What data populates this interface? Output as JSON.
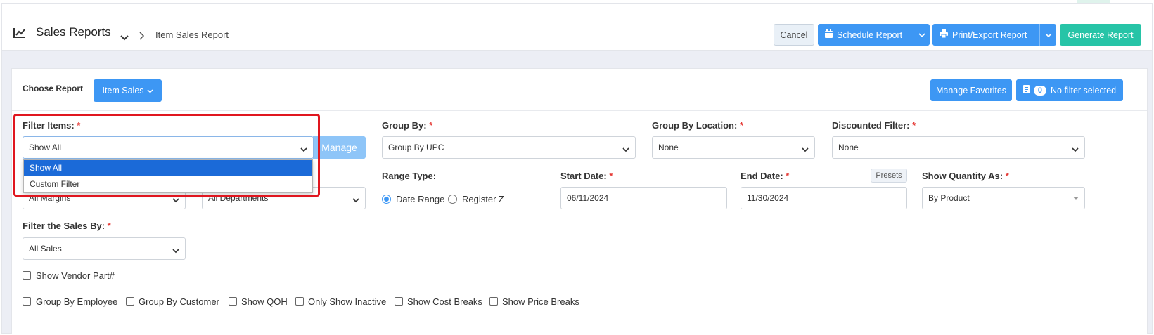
{
  "header": {
    "title": "Sales Reports",
    "breadcrumb": "Item Sales Report",
    "cancel_label": "Cancel",
    "schedule_label": "Schedule Report",
    "print_label": "Print/Export Report",
    "generate_label": "Generate Report"
  },
  "choose": {
    "label": "Choose Report",
    "report_button": "Item Sales",
    "favorites_label": "Manage Favorites",
    "filter_count": "0",
    "filter_status": "No filter selected"
  },
  "filters": {
    "filter_items": {
      "label": "Filter Items:",
      "value": "Show All",
      "manage_label": "Manage",
      "options": [
        "Show All",
        "Custom Filter"
      ]
    },
    "group_by": {
      "label": "Group By:",
      "value": "Group By UPC"
    },
    "group_by_location": {
      "label": "Group By Location:",
      "value": "None"
    },
    "discounted_filter": {
      "label": "Discounted Filter:",
      "value": "None"
    },
    "margins": {
      "value": "All Margins"
    },
    "departments": {
      "value": "All Departments"
    },
    "range_type": {
      "label": "Range Type:",
      "option_date": "Date Range",
      "option_register": "Register Z",
      "selected": "Date Range"
    },
    "start_date": {
      "label": "Start Date:",
      "value": "06/11/2024"
    },
    "end_date": {
      "label": "End Date:",
      "value": "11/30/2024",
      "presets_label": "Presets"
    },
    "show_quantity": {
      "label": "Show Quantity As:",
      "value": "By Product"
    },
    "filter_sales_by": {
      "label": "Filter the Sales By:",
      "value": "All Sales"
    }
  },
  "checkboxes": {
    "vendor_part": "Show Vendor Part#",
    "group_employee": "Group By Employee",
    "group_customer": "Group By Customer",
    "show_qoh": "Show QOH",
    "only_inactive": "Only Show Inactive",
    "cost_breaks": "Show Cost Breaks",
    "price_breaks": "Show Price Breaks"
  },
  "colors": {
    "primary": "#3d97f4",
    "success": "#27c4a7",
    "highlight": "#e0161f",
    "selected_option": "#1b6ad8"
  }
}
